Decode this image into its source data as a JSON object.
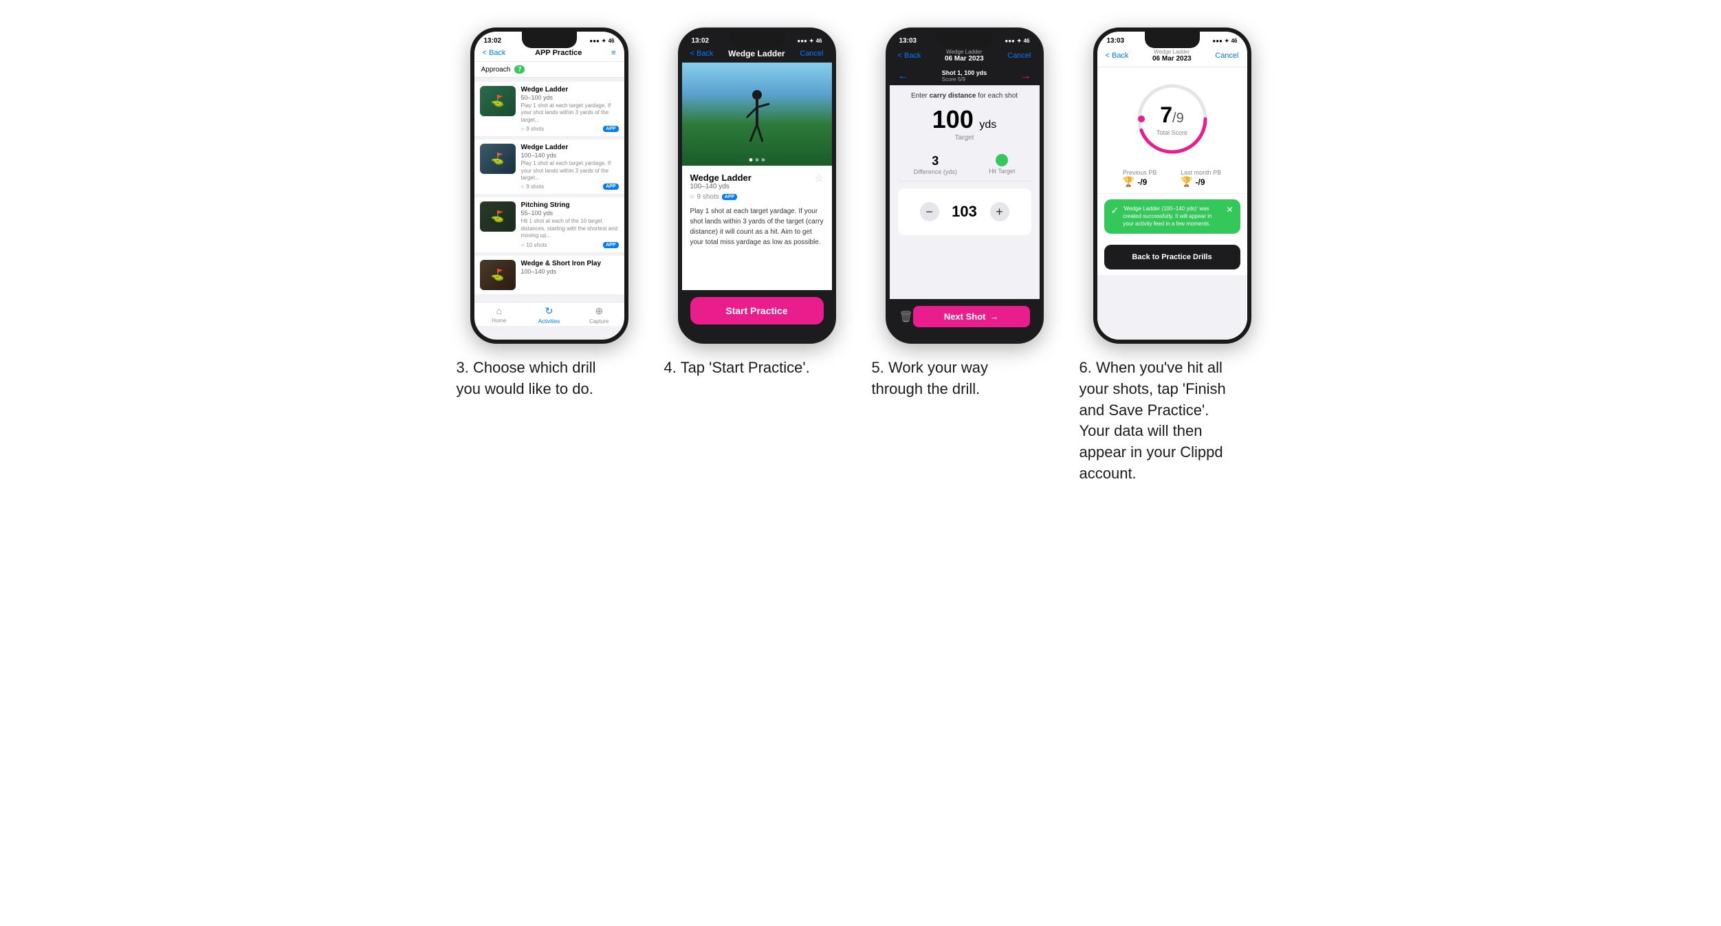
{
  "phones": [
    {
      "id": "phone3",
      "statusBar": {
        "time": "13:02",
        "signal": "●●● ✦ 46"
      },
      "nav": {
        "back": "< Back",
        "title": "APP Practice",
        "right": "≡"
      },
      "filterLabel": "Approach",
      "filterCount": "7",
      "drills": [
        {
          "name": "Wedge Ladder",
          "yds": "50–100 yds",
          "desc": "Play 1 shot at each target yardage. If your shot lands within 3 yards of the target...",
          "shots": "9 shots",
          "badge": "APP"
        },
        {
          "name": "Wedge Ladder",
          "yds": "100–140 yds",
          "desc": "Play 1 shot at each target yardage. If your shot lands within 3 yards of the target...",
          "shots": "9 shots",
          "badge": "APP"
        },
        {
          "name": "Pitching String",
          "yds": "55–100 yds",
          "desc": "Hit 1 shot at each of the 10 target distances, starting with the shortest and moving up...",
          "shots": "10 shots",
          "badge": "APP"
        },
        {
          "name": "Wedge & Short Iron Play",
          "yds": "100–140 yds",
          "desc": "",
          "shots": "",
          "badge": ""
        }
      ],
      "tabs": [
        {
          "label": "Home",
          "icon": "⌂",
          "active": false
        },
        {
          "label": "Activities",
          "icon": "♻",
          "active": true
        },
        {
          "label": "Capture",
          "icon": "⊕",
          "active": false
        }
      ],
      "caption": "3. Choose which drill you would like to do."
    },
    {
      "id": "phone4",
      "statusBar": {
        "time": "13:02",
        "signal": "●●● ✦ 46"
      },
      "nav": {
        "back": "< Back",
        "title": "Wedge Ladder",
        "right": "Cancel"
      },
      "drillName": "Wedge Ladder",
      "drillYds": "100–140 yds",
      "shots": "9 shots",
      "badge": "APP",
      "desc": "Play 1 shot at each target yardage. If your shot lands within 3 yards of the target (carry distance) it will count as a hit. Aim to get your total miss yardage as low as possible.",
      "startBtn": "Start Practice",
      "caption": "4. Tap 'Start Practice'."
    },
    {
      "id": "phone5",
      "statusBar": {
        "time": "13:03",
        "signal": "●●● ✦ 46"
      },
      "nav": {
        "back": "< Back",
        "titleSmall": "Wedge Ladder",
        "titleMain": "06 Mar 2023",
        "right": "Cancel"
      },
      "shotLabel": "Shot 1, 100 yds",
      "scoreLabel": "Score 5/9",
      "instruction": "Enter carry distance for each shot",
      "targetYds": "100",
      "targetUnit": "yds",
      "targetLabel": "Target",
      "diffValue": "3",
      "diffLabel": "Difference (yds)",
      "hitLabel": "Hit Target",
      "inputValue": "103",
      "nextShot": "Next Shot",
      "caption": "5. Work your way through the drill."
    },
    {
      "id": "phone6",
      "statusBar": {
        "time": "13:03",
        "signal": "●●● ✦ 46"
      },
      "nav": {
        "back": "< Back",
        "titleSmall": "Wedge Ladder",
        "titleMain": "06 Mar 2023",
        "right": "Cancel"
      },
      "scoreNum": "7",
      "scoreDenom": "/9",
      "scoreLabel": "Total Score",
      "prevPbLabel": "Previous PB",
      "prevPbVal": "-/9",
      "lastMonthLabel": "Last month PB",
      "lastMonthVal": "-/9",
      "toastText": "'Wedge Ladder (100–140 yds)' was created successfully. It will appear in your activity feed in a few moments.",
      "backBtn": "Back to Practice Drills",
      "caption": "6. When you've hit all your shots, tap 'Finish and Save Practice'. Your data will then appear in your Clippd account."
    }
  ]
}
